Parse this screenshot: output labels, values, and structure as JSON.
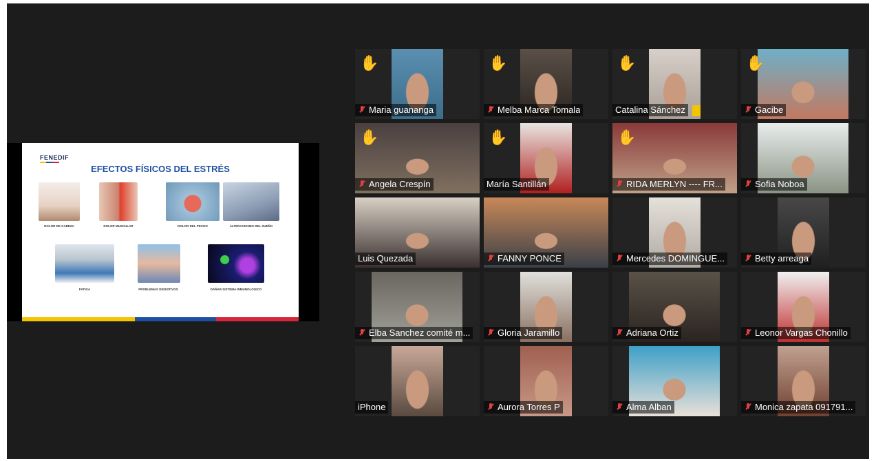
{
  "slide": {
    "logo": "FENEDIF",
    "title": "EFECTOS FÍSICOS DEL ESTRÉS",
    "captions": [
      "DOLOR DE CABEZA",
      "DOLOR MUSCULAR",
      "DOLOR DEL PECHO",
      "ALTERACIONES DEL SUEÑO",
      "FATIGA",
      "PROBLEMAS DIGESTIVOS",
      "DAÑAR SISTEMA INMUNOLOGICO"
    ],
    "colors": {
      "yellow": "#f5c400",
      "blue": "#1f4fa0",
      "red": "#d8253c"
    }
  },
  "participants": [
    {
      "name": "Maria guananga",
      "muted": true,
      "hand": true
    },
    {
      "name": "Melba Marca Tomala",
      "muted": true,
      "hand": true
    },
    {
      "name": "Catalina Sánchez",
      "muted": false,
      "hand": true
    },
    {
      "name": "Gacibe",
      "muted": true,
      "hand": true
    },
    {
      "name": "Angela Crespín",
      "muted": true,
      "hand": true
    },
    {
      "name": "María Santillán",
      "muted": false,
      "hand": true
    },
    {
      "name": "RIDA MERLYN ---- FR...",
      "muted": true,
      "hand": true
    },
    {
      "name": "Sofia Noboa",
      "muted": true,
      "hand": false
    },
    {
      "name": "Luis Quezada",
      "muted": false,
      "hand": false,
      "active": true
    },
    {
      "name": "FANNY PONCE",
      "muted": true,
      "hand": false
    },
    {
      "name": "Mercedes DOMINGUE...",
      "muted": true,
      "hand": false
    },
    {
      "name": "Betty arreaga",
      "muted": true,
      "hand": false
    },
    {
      "name": "Elba Sanchez comité m...",
      "muted": true,
      "hand": false
    },
    {
      "name": "Gloria Jaramillo",
      "muted": true,
      "hand": false
    },
    {
      "name": "Adriana Ortiz",
      "muted": true,
      "hand": false
    },
    {
      "name": "Leonor Vargas Chonillo",
      "muted": true,
      "hand": false
    },
    {
      "name": "iPhone",
      "muted": false,
      "hand": false
    },
    {
      "name": "Aurora Torres P",
      "muted": true,
      "hand": false
    },
    {
      "name": "Alma Alban",
      "muted": true,
      "hand": false
    },
    {
      "name": "Monica zapata 091791...",
      "muted": true,
      "hand": false
    }
  ],
  "icons": {
    "hand": "raised-hand-icon",
    "mic": "muted-mic-icon"
  },
  "accent": {
    "active_border": "#d3e05a",
    "muted_red": "#e04040",
    "hand_yellow": "#f5b800"
  }
}
